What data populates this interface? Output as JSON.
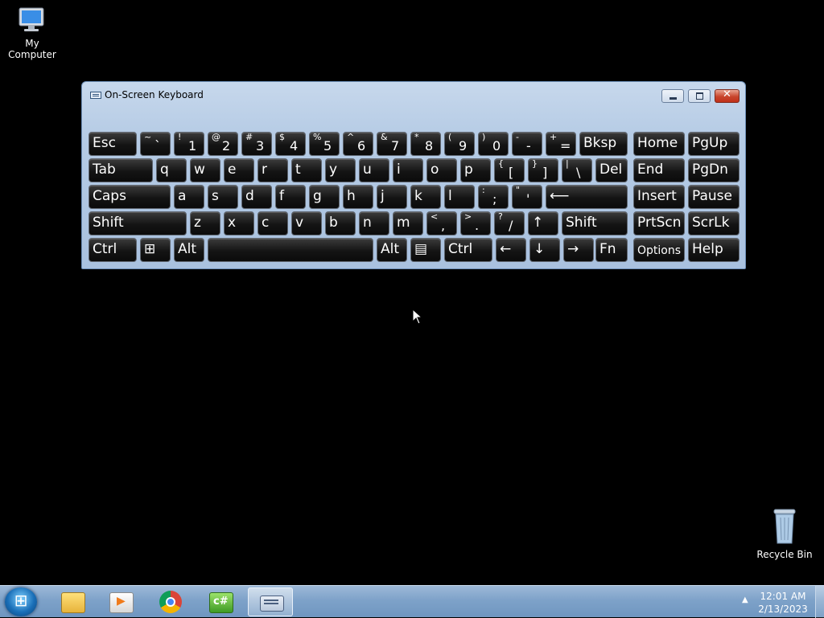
{
  "desktop": {
    "icons": [
      {
        "label": "My Computer"
      },
      {
        "label": "Recycle Bin"
      }
    ]
  },
  "osk": {
    "title": "On-Screen Keyboard",
    "close_glyph": "✕",
    "rows": [
      [
        {
          "name": "key-esc",
          "main": "Esc"
        },
        {
          "name": "key-tilde",
          "shift": "~",
          "main": "`"
        },
        {
          "name": "key-1",
          "shift": "!",
          "main": "1"
        },
        {
          "name": "key-2",
          "shift": "@",
          "main": "2"
        },
        {
          "name": "key-3",
          "shift": "#",
          "main": "3"
        },
        {
          "name": "key-4",
          "shift": "$",
          "main": "4"
        },
        {
          "name": "key-5",
          "shift": "%",
          "main": "5"
        },
        {
          "name": "key-6",
          "shift": "^",
          "main": "6"
        },
        {
          "name": "key-7",
          "shift": "&",
          "main": "7"
        },
        {
          "name": "key-8",
          "shift": "*",
          "main": "8"
        },
        {
          "name": "key-9",
          "shift": "(",
          "main": "9"
        },
        {
          "name": "key-0",
          "shift": ")",
          "main": "0"
        },
        {
          "name": "key-minus",
          "shift": "-",
          "main": "-"
        },
        {
          "name": "key-equals",
          "shift": "+",
          "main": "="
        },
        {
          "name": "key-bksp",
          "main": "Bksp"
        },
        {
          "name": "key-home",
          "main": "Home"
        },
        {
          "name": "key-pgup",
          "main": "PgUp"
        }
      ],
      [
        {
          "name": "key-tab",
          "main": "Tab"
        },
        {
          "name": "key-q",
          "main": "q"
        },
        {
          "name": "key-w",
          "main": "w"
        },
        {
          "name": "key-e",
          "main": "e"
        },
        {
          "name": "key-r",
          "main": "r"
        },
        {
          "name": "key-t",
          "main": "t"
        },
        {
          "name": "key-y",
          "main": "y"
        },
        {
          "name": "key-u",
          "main": "u"
        },
        {
          "name": "key-i",
          "main": "i"
        },
        {
          "name": "key-o",
          "main": "o"
        },
        {
          "name": "key-p",
          "main": "p"
        },
        {
          "name": "key-lbracket",
          "shift": "{",
          "main": "["
        },
        {
          "name": "key-rbracket",
          "shift": "}",
          "main": "]"
        },
        {
          "name": "key-backslash",
          "shift": "|",
          "main": "\\"
        },
        {
          "name": "key-del",
          "main": "Del"
        },
        {
          "name": "key-end",
          "main": "End"
        },
        {
          "name": "key-pgdn",
          "main": "PgDn"
        }
      ],
      [
        {
          "name": "key-caps",
          "main": "Caps"
        },
        {
          "name": "key-a",
          "main": "a"
        },
        {
          "name": "key-s",
          "main": "s"
        },
        {
          "name": "key-d",
          "main": "d"
        },
        {
          "name": "key-f",
          "main": "f"
        },
        {
          "name": "key-g",
          "main": "g"
        },
        {
          "name": "key-h",
          "main": "h"
        },
        {
          "name": "key-j",
          "main": "j"
        },
        {
          "name": "key-k",
          "main": "k"
        },
        {
          "name": "key-l",
          "main": "l"
        },
        {
          "name": "key-semicolon",
          "shift": ":",
          "main": ";"
        },
        {
          "name": "key-quote",
          "shift": "\"",
          "main": "'"
        },
        {
          "name": "key-enter",
          "main": "⟵"
        },
        {
          "name": "key-insert",
          "main": "Insert"
        },
        {
          "name": "key-pause",
          "main": "Pause"
        }
      ],
      [
        {
          "name": "key-lshift",
          "main": "Shift"
        },
        {
          "name": "key-z",
          "main": "z"
        },
        {
          "name": "key-x",
          "main": "x"
        },
        {
          "name": "key-c",
          "main": "c"
        },
        {
          "name": "key-v",
          "main": "v"
        },
        {
          "name": "key-b",
          "main": "b"
        },
        {
          "name": "key-n",
          "main": "n"
        },
        {
          "name": "key-m",
          "main": "m"
        },
        {
          "name": "key-comma",
          "shift": "<",
          "main": ","
        },
        {
          "name": "key-period",
          "shift": ">",
          "main": "."
        },
        {
          "name": "key-slash",
          "shift": "?",
          "main": "/"
        },
        {
          "name": "key-up",
          "main": "↑"
        },
        {
          "name": "key-rshift",
          "main": "Shift"
        },
        {
          "name": "key-prtscn",
          "main": "PrtScn"
        },
        {
          "name": "key-scrlk",
          "main": "ScrLk"
        }
      ],
      [
        {
          "name": "key-lctrl",
          "main": "Ctrl"
        },
        {
          "name": "key-win",
          "main": "⊞"
        },
        {
          "name": "key-lalt",
          "main": "Alt"
        },
        {
          "name": "key-space",
          "main": ""
        },
        {
          "name": "key-ralt",
          "main": "Alt"
        },
        {
          "name": "key-menu",
          "main": "▤"
        },
        {
          "name": "key-rctrl",
          "main": "Ctrl"
        },
        {
          "name": "key-left",
          "main": "←"
        },
        {
          "name": "key-down",
          "main": "↓"
        },
        {
          "name": "key-right",
          "main": "→"
        },
        {
          "name": "key-fn",
          "main": "Fn"
        },
        {
          "name": "key-options",
          "main": "Options"
        },
        {
          "name": "key-help",
          "main": "Help"
        }
      ]
    ]
  },
  "taskbar": {
    "items": [
      {
        "name": "start-button",
        "icon": "windows-start-icon"
      },
      {
        "name": "explorer",
        "icon": "folder-icon"
      },
      {
        "name": "media-player",
        "icon": "media-player-icon"
      },
      {
        "name": "chrome",
        "icon": "chrome-icon"
      },
      {
        "name": "csharp",
        "icon": "csharp-icon",
        "glyph": "c#"
      },
      {
        "name": "on-screen-keyboard",
        "icon": "keyboard-icon"
      }
    ],
    "tray_arrow": "▲",
    "time": "12:01 AM",
    "date": "2/13/2023"
  }
}
